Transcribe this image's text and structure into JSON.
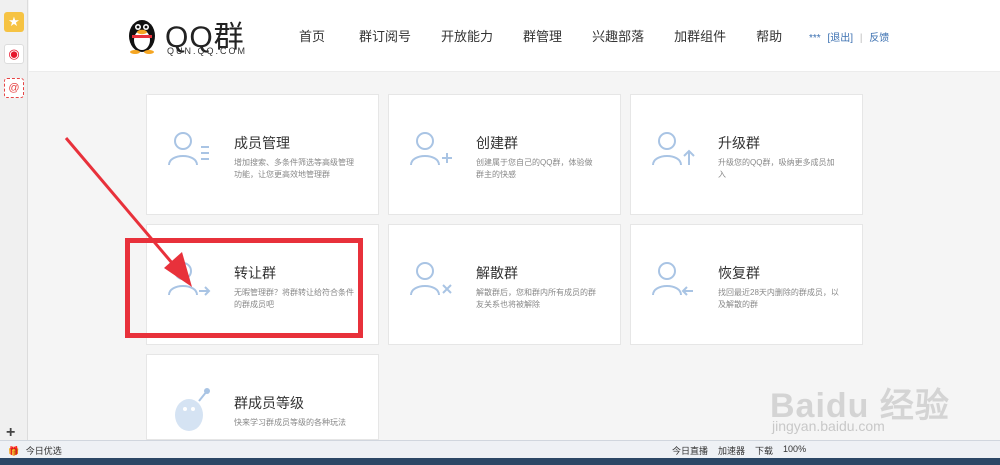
{
  "sidebar": {
    "fav_icon": "★",
    "weibo_icon": "◉",
    "mail_icon": "@",
    "add_icon": "+"
  },
  "logo": {
    "title": "QQ群",
    "subtitle": "QUN.QQ.COM"
  },
  "nav": [
    "首页",
    "群订阅号",
    "开放能力",
    "群管理",
    "兴趣部落",
    "加群组件",
    "帮助"
  ],
  "user": {
    "name": "***",
    "logout": "[退出]",
    "sep": "|",
    "feedback": "反馈"
  },
  "cards": [
    {
      "title": "成员管理",
      "desc": "增加搜索、多条件筛选等高级管理功能，让您更高效地管理群"
    },
    {
      "title": "创建群",
      "desc": "创建属于您自己的QQ群，体验做群主的快感"
    },
    {
      "title": "升级群",
      "desc": "升级您的QQ群，吸纳更多成员加入"
    },
    {
      "title": "转让群",
      "desc": "无暇管理群？将群转让给符合条件的群成员吧"
    },
    {
      "title": "解散群",
      "desc": "解散群后，您和群内所有成员的群友关系也将被解除"
    },
    {
      "title": "恢复群",
      "desc": "找回最近28天内删除的群成员，以及解散的群"
    },
    {
      "title": "群成员等级",
      "desc": "快来学习群成员等级的各种玩法"
    }
  ],
  "statusbar": {
    "left": "今日优选",
    "live": "今日直播",
    "accelerator": "加速器",
    "download": "下载",
    "zoom": "100%"
  },
  "watermark": {
    "main": "Baidu 经验",
    "sub": "jingyan.baidu.com"
  }
}
